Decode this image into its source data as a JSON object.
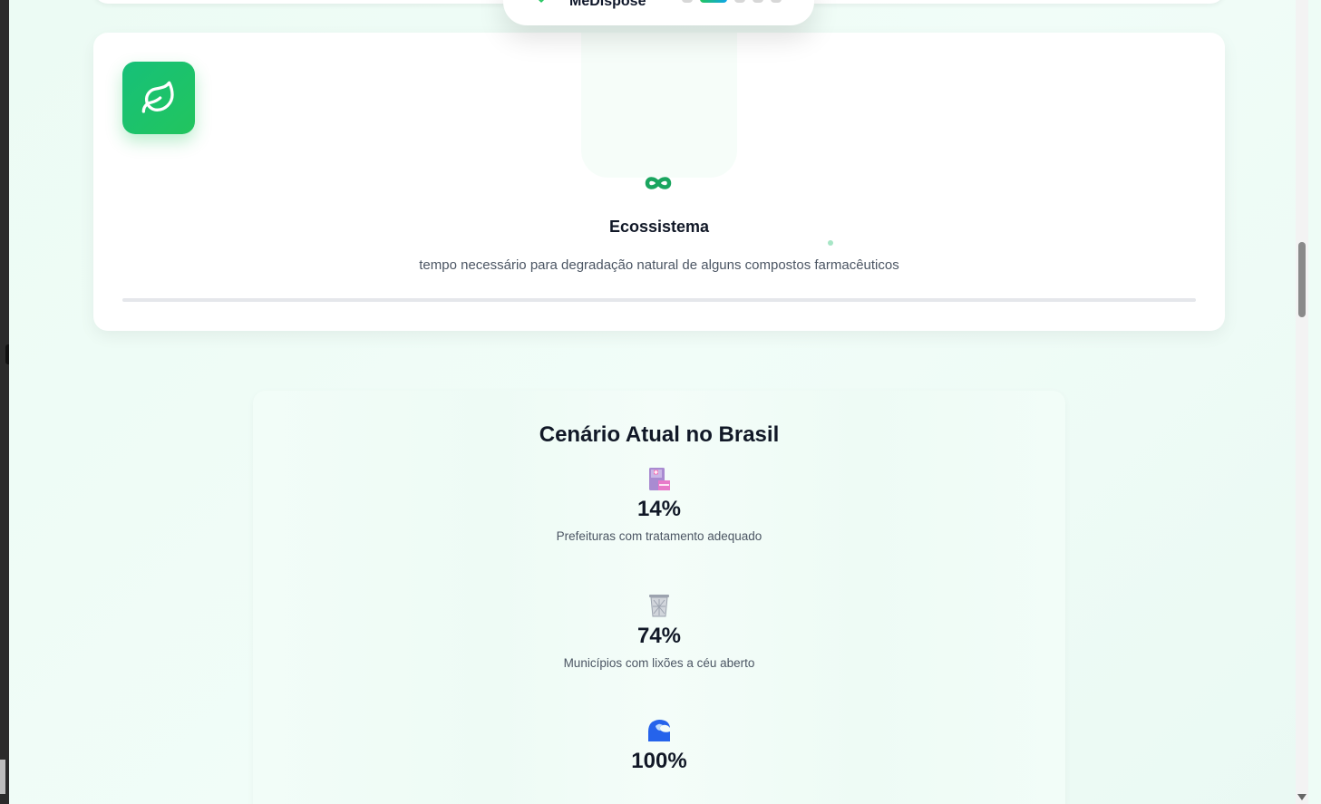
{
  "nav": {
    "brand": "MeDispose",
    "dots": [
      false,
      true,
      false,
      false,
      false
    ]
  },
  "eco_card": {
    "icon": "leaf-icon",
    "symbol": "infinity-icon",
    "title": "Ecossistema",
    "description": "tempo necessário para degradação natural de alguns compostos farmacêuticos"
  },
  "brazil": {
    "title": "Cenário Atual no Brasil",
    "stats": [
      {
        "icon": "pharmacy-building-icon",
        "value": "14%",
        "label": "Prefeituras com tratamento adequado"
      },
      {
        "icon": "wastebasket-icon",
        "value": "74%",
        "label": "Municípios com lixões a céu aberto"
      },
      {
        "icon": "water-wave-icon",
        "value": "100%",
        "label": ""
      }
    ]
  },
  "colors": {
    "accent_green": "#22c55e",
    "accent_blue": "#0ea5e9",
    "text_dark": "#111827",
    "text_muted": "#4b5563"
  }
}
